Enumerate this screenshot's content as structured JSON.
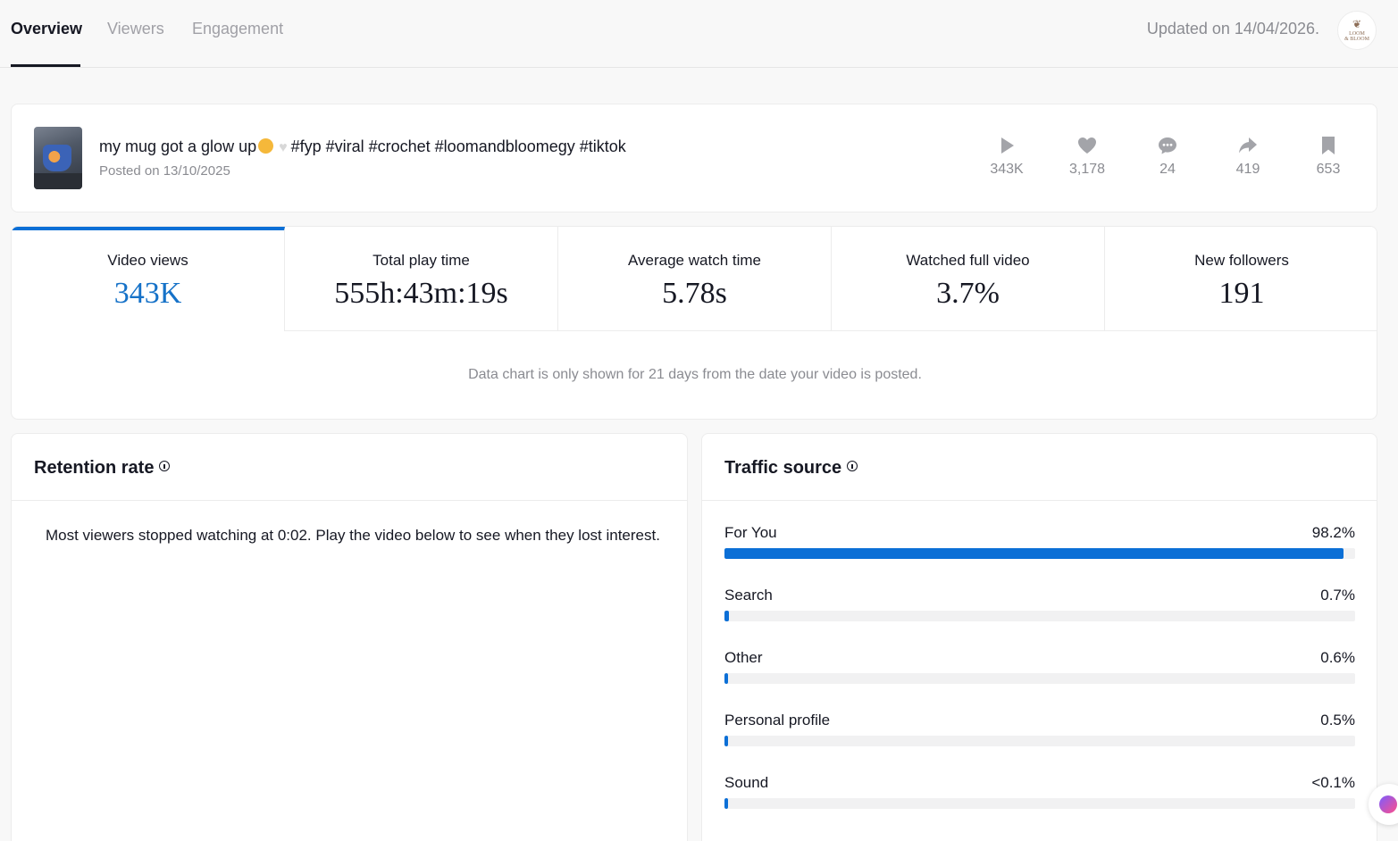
{
  "tabs": [
    {
      "label": "Overview",
      "active": true
    },
    {
      "label": "Viewers",
      "active": false
    },
    {
      "label": "Engagement",
      "active": false
    }
  ],
  "updated_text": "Updated on 14/04/2026.",
  "brand_logo": {
    "line1": "LOOM",
    "line2": "& BLOOM"
  },
  "video": {
    "title_prefix": "my mug got a glow up",
    "title_suffix": "#fyp #viral #crochet #loomandbloomegy #tiktok",
    "posted": "Posted on 13/10/2025",
    "stats": [
      {
        "icon": "play-icon",
        "value": "343K"
      },
      {
        "icon": "heart-icon",
        "value": "3,178"
      },
      {
        "icon": "comment-icon",
        "value": "24"
      },
      {
        "icon": "share-icon",
        "value": "419"
      },
      {
        "icon": "bookmark-icon",
        "value": "653"
      }
    ]
  },
  "metrics": [
    {
      "label": "Video views",
      "value": "343K",
      "active": true
    },
    {
      "label": "Total play time",
      "value": "555h:43m:19s",
      "active": false
    },
    {
      "label": "Average watch time",
      "value": "5.78s",
      "active": false
    },
    {
      "label": "Watched full video",
      "value": "3.7%",
      "active": false
    },
    {
      "label": "New followers",
      "value": "191",
      "active": false
    }
  ],
  "chart_note": "Data chart is only shown for 21 days from the date your video is posted.",
  "retention": {
    "title": "Retention rate",
    "text": "Most viewers stopped watching at 0:02. Play the video below to see when they lost interest."
  },
  "traffic": {
    "title": "Traffic source",
    "sources": [
      {
        "label": "For You",
        "value": "98.2%",
        "fraction": 0.982
      },
      {
        "label": "Search",
        "value": "0.7%",
        "fraction": 0.007
      },
      {
        "label": "Other",
        "value": "0.6%",
        "fraction": 0.006
      },
      {
        "label": "Personal profile",
        "value": "0.5%",
        "fraction": 0.005
      },
      {
        "label": "Sound",
        "value": "<0.1%",
        "fraction": 0.001
      }
    ]
  },
  "colors": {
    "accent": "#0b6fd6",
    "text": "#161823",
    "muted": "#8a8b91",
    "background": "#f8f8f8"
  }
}
